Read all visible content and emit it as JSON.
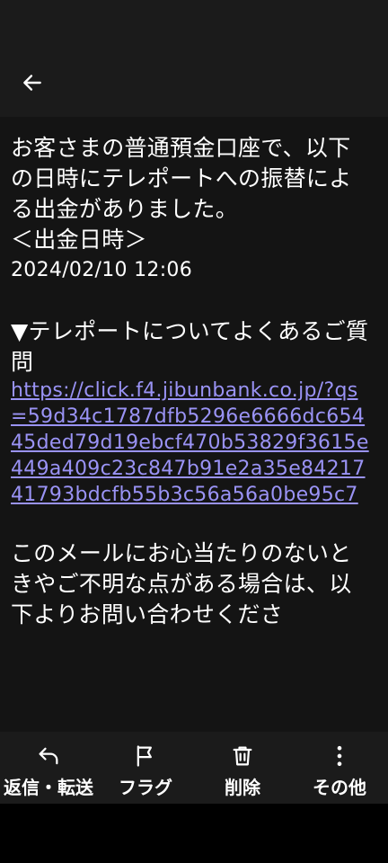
{
  "header": {
    "back_icon": "arrow-left-icon"
  },
  "message": {
    "line1": "お客さまの普通預金口座で、以下の日時にテレポートへの振替による出金がありました。",
    "date_heading": "＜出金日時＞",
    "date_value": "2024/02/10 12:06",
    "faq_heading": "▼テレポートについてよくあるご質問",
    "faq_link": "https://click.f4.jibunbank.co.jp/?qs=59d34c1787dfb5296e6666dc65445ded79d19ebcf470b53829f3615e449a409c23c847b91e2a35e8421741793bdcfb55b3c56a56a0be95c7",
    "contact_text": "このメールにお心当たりのないときやご不明な点がある場合は、以下よりお問い合わせくださ"
  },
  "actions": [
    {
      "label": "返信・転送",
      "icon": "reply-icon"
    },
    {
      "label": "フラグ",
      "icon": "flag-icon"
    },
    {
      "label": "削除",
      "icon": "trash-icon"
    },
    {
      "label": "その他",
      "icon": "more-vertical-icon"
    }
  ],
  "colors": {
    "background": "#141414",
    "bar": "#1b1b1b",
    "link": "#9a93f5",
    "text": "#ffffff"
  }
}
